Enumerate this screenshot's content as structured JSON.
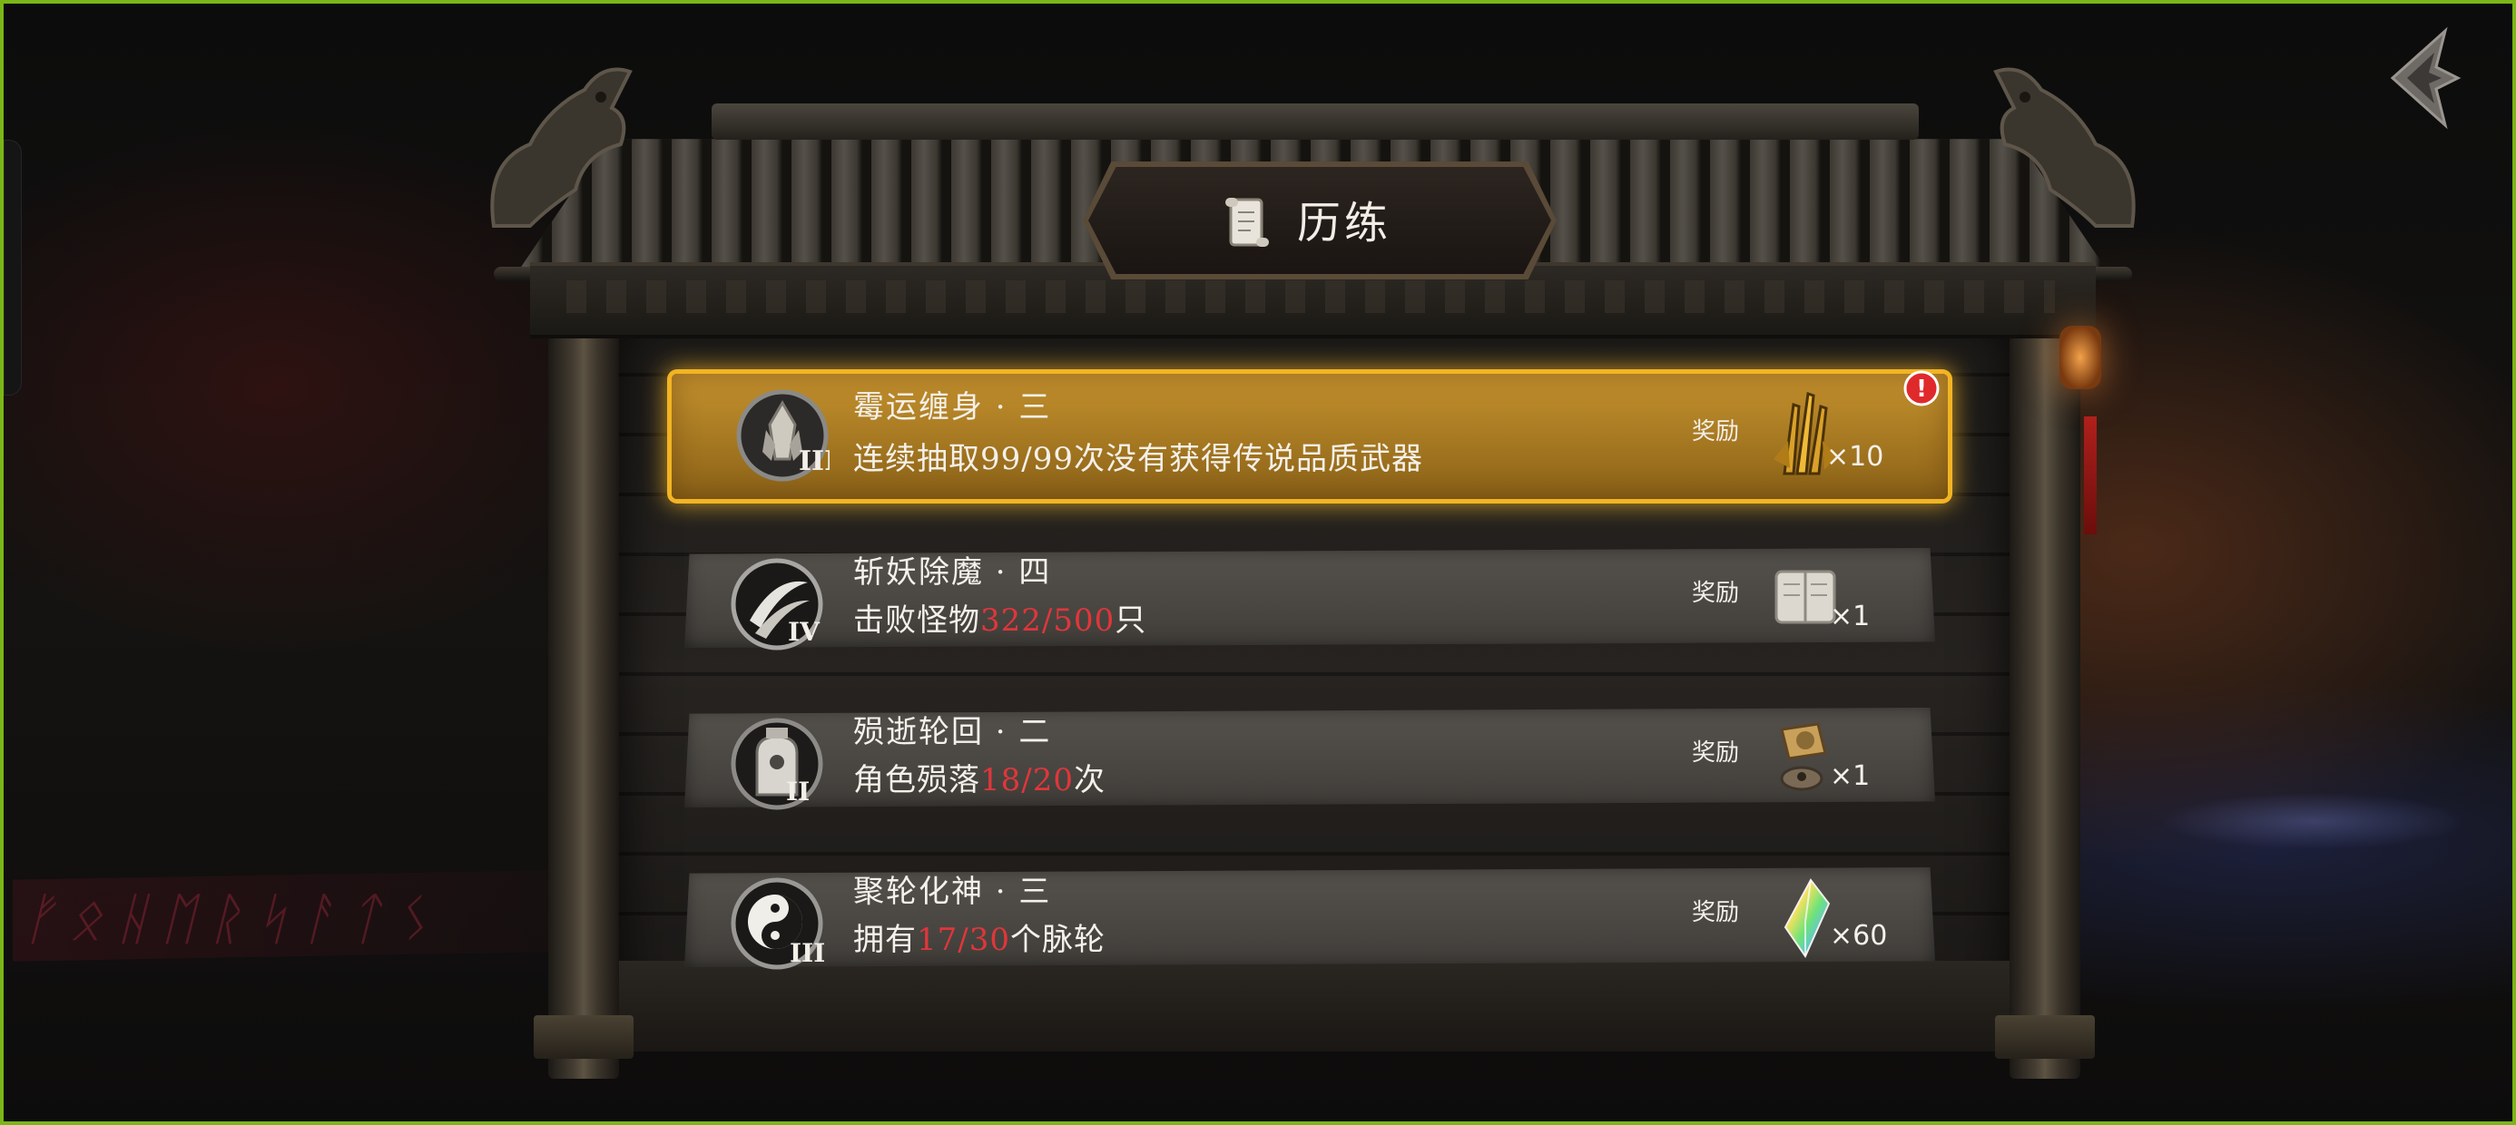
{
  "screen": {
    "title": "历练",
    "accent_color": "#f2b423",
    "progress_color": "#e0363a"
  },
  "background": {
    "glyph_text": "ᚠᛟᚺᛖᚱᛋᚨᛏᛊ"
  },
  "quests": [
    {
      "name": "霉运缠身 · 三",
      "desc_prefix": "连续抽取99/99次没有获得传说品质武器",
      "progress": "",
      "desc_suffix": "",
      "tier": "III",
      "medal_icon": "crystal-medal-icon",
      "reward_label": "奖励",
      "reward_icon": "golden-claw-icon",
      "reward_qty": "×10",
      "highlighted": true,
      "has_alert": true,
      "alert_mark": "!"
    },
    {
      "name": "斩妖除魔 · 四",
      "desc_prefix": "击败怪物",
      "progress": "322/500",
      "desc_suffix": "只",
      "tier": "IV",
      "medal_icon": "slash-medal-icon",
      "reward_label": "奖励",
      "reward_icon": "scroll-book-icon",
      "reward_qty": "×1",
      "highlighted": false,
      "has_alert": false
    },
    {
      "name": "殒逝轮回 · 二",
      "desc_prefix": "角色殒落",
      "progress": "18/20",
      "desc_suffix": "次",
      "tier": "II",
      "medal_icon": "tombstone-medal-icon",
      "reward_label": "奖励",
      "reward_icon": "compass-icon",
      "reward_qty": "×1",
      "highlighted": false,
      "has_alert": false
    },
    {
      "name": "聚轮化神 · 三",
      "desc_prefix": "拥有",
      "progress": "17/30",
      "desc_suffix": "个脉轮",
      "tier": "III",
      "medal_icon": "yin-yang-medal-icon",
      "reward_label": "奖励",
      "reward_icon": "rainbow-crystal-icon",
      "reward_qty": "×60",
      "highlighted": false,
      "has_alert": false
    }
  ]
}
